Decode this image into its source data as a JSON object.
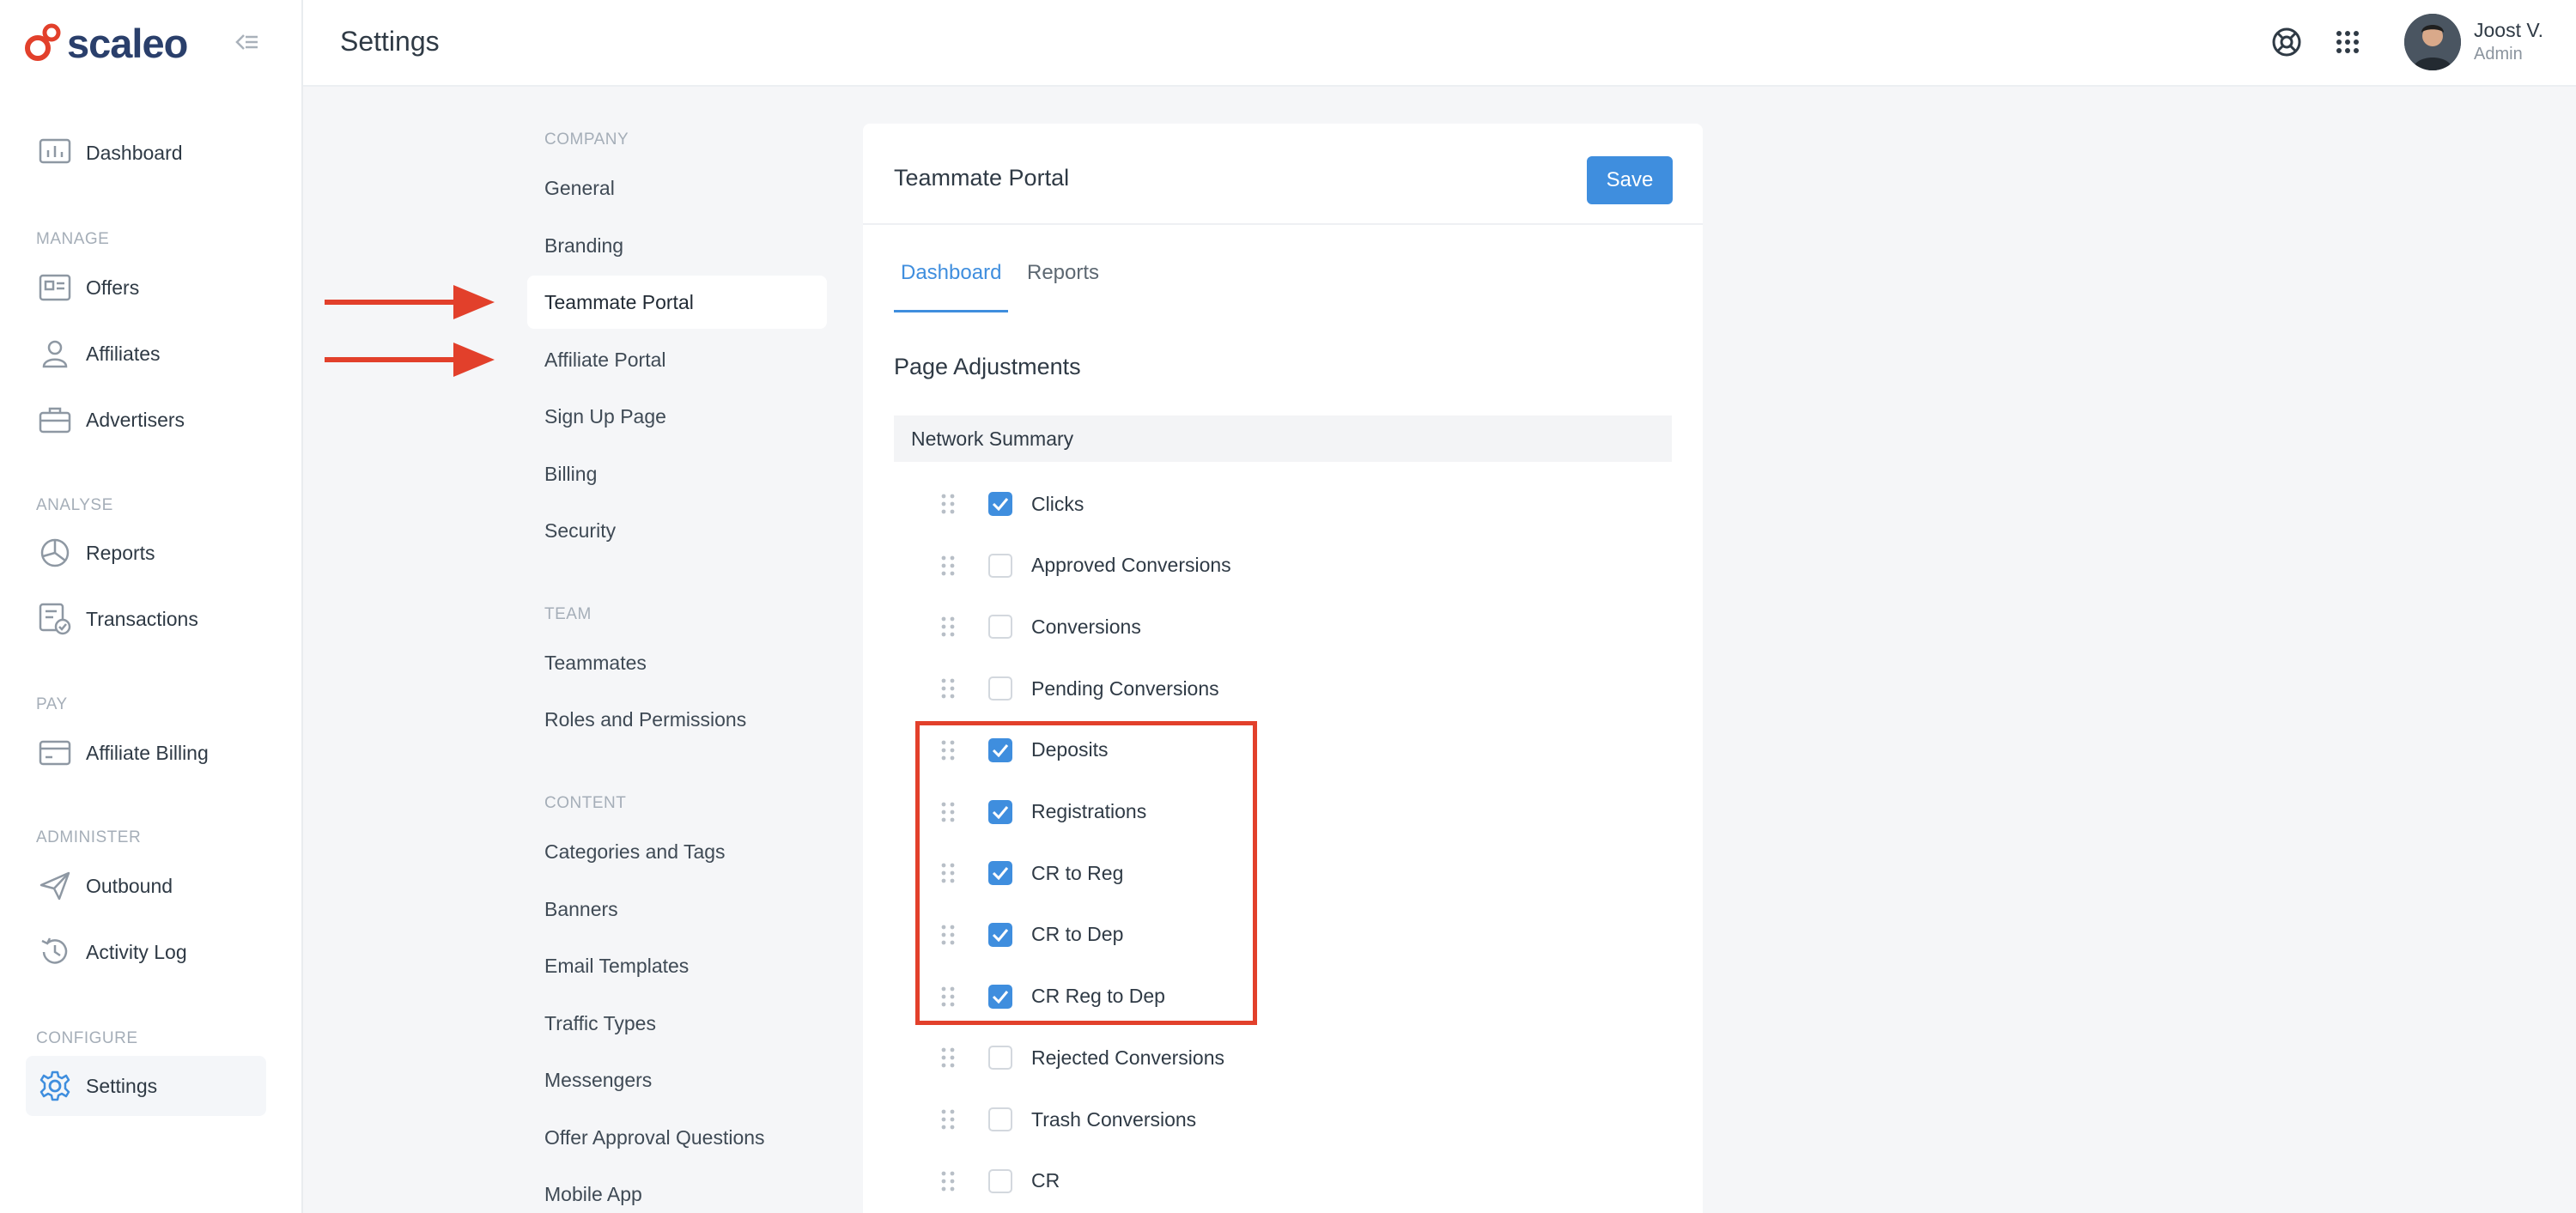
{
  "app": {
    "logo_text": "scaleo",
    "page_title": "Settings"
  },
  "user": {
    "name": "Joost V.",
    "role": "Admin"
  },
  "sidebar": {
    "dashboard": {
      "label": "Dashboard",
      "icon": "dashboard-icon"
    },
    "sections": [
      {
        "title": "MANAGE",
        "items": [
          {
            "label": "Offers",
            "icon": "offers-icon"
          },
          {
            "label": "Affiliates",
            "icon": "user-icon"
          },
          {
            "label": "Advertisers",
            "icon": "briefcase-icon"
          }
        ]
      },
      {
        "title": "ANALYSE",
        "items": [
          {
            "label": "Reports",
            "icon": "pie-chart-icon"
          },
          {
            "label": "Transactions",
            "icon": "transactions-icon"
          }
        ]
      },
      {
        "title": "PAY",
        "items": [
          {
            "label": "Affiliate Billing",
            "icon": "credit-card-icon"
          }
        ]
      },
      {
        "title": "ADMINISTER",
        "items": [
          {
            "label": "Outbound",
            "icon": "paper-plane-icon"
          },
          {
            "label": "Activity Log",
            "icon": "history-icon"
          }
        ]
      },
      {
        "title": "CONFIGURE",
        "items": [
          {
            "label": "Settings",
            "icon": "gear-icon",
            "active": true
          }
        ]
      }
    ]
  },
  "settings_nav": {
    "company": {
      "title": "COMPANY",
      "items": [
        "General",
        "Branding",
        "Teammate Portal",
        "Affiliate Portal",
        "Sign Up Page",
        "Billing",
        "Security"
      ]
    },
    "team": {
      "title": "TEAM",
      "items": [
        "Teammates",
        "Roles and Permissions"
      ]
    },
    "content": {
      "title": "CONTENT",
      "items": [
        "Categories and Tags",
        "Banners",
        "Email Templates",
        "Traffic Types",
        "Messengers",
        "Offer Approval Questions",
        "Mobile App"
      ]
    },
    "active": "Teammate Portal"
  },
  "card": {
    "title": "Teammate Portal",
    "save_label": "Save",
    "tabs": [
      {
        "label": "Dashboard",
        "active": true
      },
      {
        "label": "Reports",
        "active": false
      }
    ],
    "section_heading": "Page Adjustments",
    "group_title": "Network Summary",
    "rows": [
      {
        "label": "Clicks",
        "checked": true
      },
      {
        "label": "Approved Conversions",
        "checked": false
      },
      {
        "label": "Conversions",
        "checked": false
      },
      {
        "label": "Pending Conversions",
        "checked": false
      },
      {
        "label": "Deposits",
        "checked": true
      },
      {
        "label": "Registrations",
        "checked": true
      },
      {
        "label": "CR to Reg",
        "checked": true
      },
      {
        "label": "CR to Dep",
        "checked": true
      },
      {
        "label": "CR Reg to Dep",
        "checked": true
      },
      {
        "label": "Rejected Conversions",
        "checked": false
      },
      {
        "label": "Trash Conversions",
        "checked": false
      },
      {
        "label": "CR",
        "checked": false
      }
    ]
  },
  "colors": {
    "accent": "#3f8ede",
    "annotation": "#e2402b",
    "brand": "#2a3f6b"
  }
}
